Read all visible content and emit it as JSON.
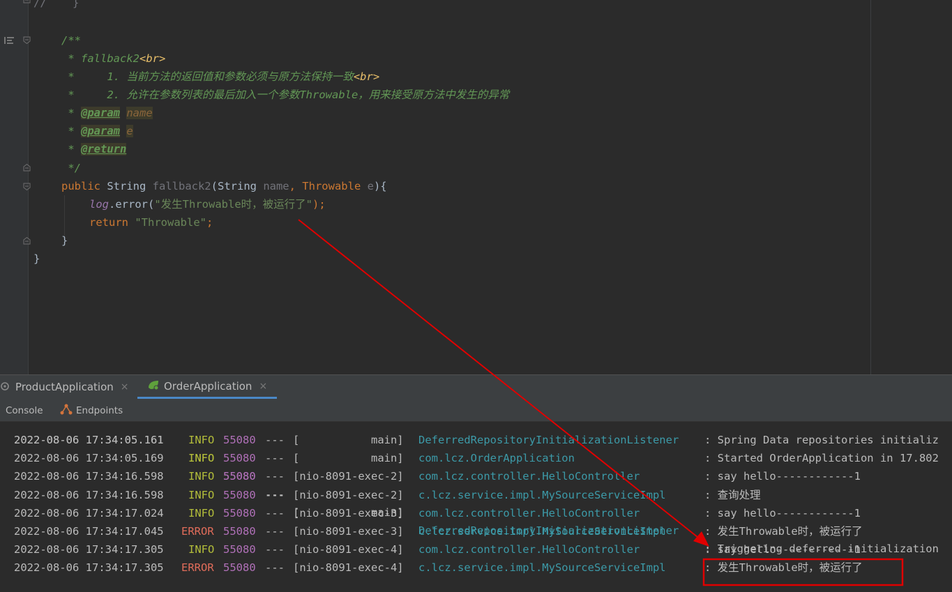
{
  "editor": {
    "lines": {
      "l0": "//    }",
      "l1_open": "/**",
      "l2_star": " * ",
      "l2_text": "fallback2",
      "l2_tag": "<br>",
      "l3_star": " *     ",
      "l3_text": "1. 当前方法的返回值和参数必须与原方法保持一致",
      "l3_tag": "<br>",
      "l4_star": " *     ",
      "l4_text": "2. 允许在参数列表的最后加入一个参数Throwable，用来接受原方法中发生的异常",
      "l5_star": " * ",
      "l5_tag": "@param",
      "l5_param": "name",
      "l6_star": " * ",
      "l6_tag": "@param",
      "l6_param": "e",
      "l7_star": " * ",
      "l7_tag": "@return",
      "l8_close": " */",
      "l9_kw": "public",
      "l9_type": " String ",
      "l9_name": "fallback2",
      "l9_p1": "(String ",
      "l9_pname": "name",
      "l9_p2": ", Throwable ",
      "l9_pe": "e",
      "l9_p3": "){",
      "l10_field": "log",
      "l10_call": ".error(",
      "l10_str": "\"发生Throwable时，被运行了\"",
      "l10_end": ");",
      "l11_kw": "return",
      "l11_sp": " ",
      "l11_str": "\"Throwable\"",
      "l11_end": ";",
      "l12_close": "}",
      "l13_close": "}"
    }
  },
  "run_tabs": [
    {
      "label": "ProductApplication",
      "close": "×"
    },
    {
      "label": "OrderApplication",
      "close": "×"
    }
  ],
  "sub_tabs": [
    {
      "label": "Console"
    },
    {
      "label": "Endpoints"
    }
  ],
  "console": {
    "partial": {
      "ts": "2022-08-06 17:34:05.161",
      "level": "INFO",
      "pid": "55080",
      "sep": "---",
      "thread": "[           main]",
      "logger": "DeferredRepositoryInitializationListener",
      "msg": ": Triggering deferred initialization"
    },
    "rows": [
      {
        "ts": "2022-08-06 17:34:05.161",
        "level": "INFO",
        "pid": "55080",
        "sep": "---",
        "thread": "[           main]",
        "logger": "DeferredRepositoryInitializationListener",
        "msg": ": Spring Data repositories initializ"
      },
      {
        "ts": "2022-08-06 17:34:05.169",
        "level": "INFO",
        "pid": "55080",
        "sep": "---",
        "thread": "[           main]",
        "logger": "com.lcz.OrderApplication",
        "msg": ": Started OrderApplication in 17.802"
      },
      {
        "ts": "2022-08-06 17:34:16.598",
        "level": "INFO",
        "pid": "55080",
        "sep": "---",
        "thread": "[nio-8091-exec-2]",
        "logger": "com.lcz.controller.HelloController",
        "msg": ": say hello------------1"
      },
      {
        "ts": "2022-08-06 17:34:16.598",
        "level": "INFO",
        "pid": "55080",
        "sep": "---",
        "thread": "[nio-8091-exec-2]",
        "logger": "c.lcz.service.impl.MySourceServiceImpl",
        "msg": ": 查询处理"
      },
      {
        "ts": "2022-08-06 17:34:17.024",
        "level": "INFO",
        "pid": "55080",
        "sep": "---",
        "thread": "[nio-8091-exec-3]",
        "logger": "com.lcz.controller.HelloController",
        "msg": ": say hello------------1"
      },
      {
        "ts": "2022-08-06 17:34:17.045",
        "level": "ERROR",
        "pid": "55080",
        "sep": "---",
        "thread": "[nio-8091-exec-3]",
        "logger": "c.lcz.service.impl.MySourceServiceImpl",
        "msg": ": 发生Throwable时，被运行了"
      },
      {
        "ts": "2022-08-06 17:34:17.305",
        "level": "INFO",
        "pid": "55080",
        "sep": "---",
        "thread": "[nio-8091-exec-4]",
        "logger": "com.lcz.controller.HelloController",
        "msg": ": say hello------------1"
      },
      {
        "ts": "2022-08-06 17:34:17.305",
        "level": "ERROR",
        "pid": "55080",
        "sep": "---",
        "thread": "[nio-8091-exec-4]",
        "logger": "c.lcz.service.impl.MySourceServiceImpl",
        "msg": ": 发生Throwable时，被运行了"
      }
    ]
  },
  "colors": {
    "background": "#2b2b2b",
    "comment": "#629755",
    "keyword": "#cc7832",
    "string": "#6a8759",
    "info": "#b3bd3a",
    "error": "#e06c5a",
    "annotation": "#e00000"
  }
}
